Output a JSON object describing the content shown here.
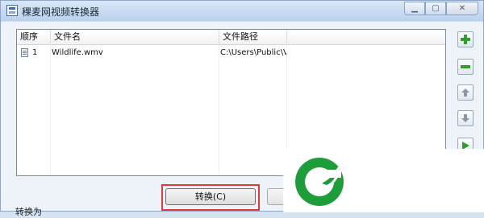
{
  "window": {
    "title": "稞麦网视频转换器",
    "icons": {
      "app": "app-icon",
      "minimize": "minimize-icon",
      "maximize": "maximize-icon",
      "close": "close-icon"
    }
  },
  "list": {
    "columns": [
      "顺序",
      "文件名",
      "文件路径"
    ],
    "rows": [
      {
        "order": "1",
        "name": "Wildlife.wmv",
        "path": "C:\\Users\\Public\\Vide"
      }
    ]
  },
  "side_buttons": [
    {
      "name": "add-icon",
      "color": "#2f9e2f"
    },
    {
      "name": "remove-icon",
      "color": "#2f9e2f"
    },
    {
      "name": "move-up-icon",
      "color": "#8a96a6"
    },
    {
      "name": "move-down-icon",
      "color": "#8a96a6"
    },
    {
      "name": "play-icon",
      "color": "#2f9e2f"
    }
  ],
  "actions": {
    "convert_label": "转换(C)"
  },
  "footer": {
    "convert_to_label": "转换为"
  },
  "colors": {
    "highlight": "#e03a3a",
    "logo_green": "#1e9e3a"
  }
}
